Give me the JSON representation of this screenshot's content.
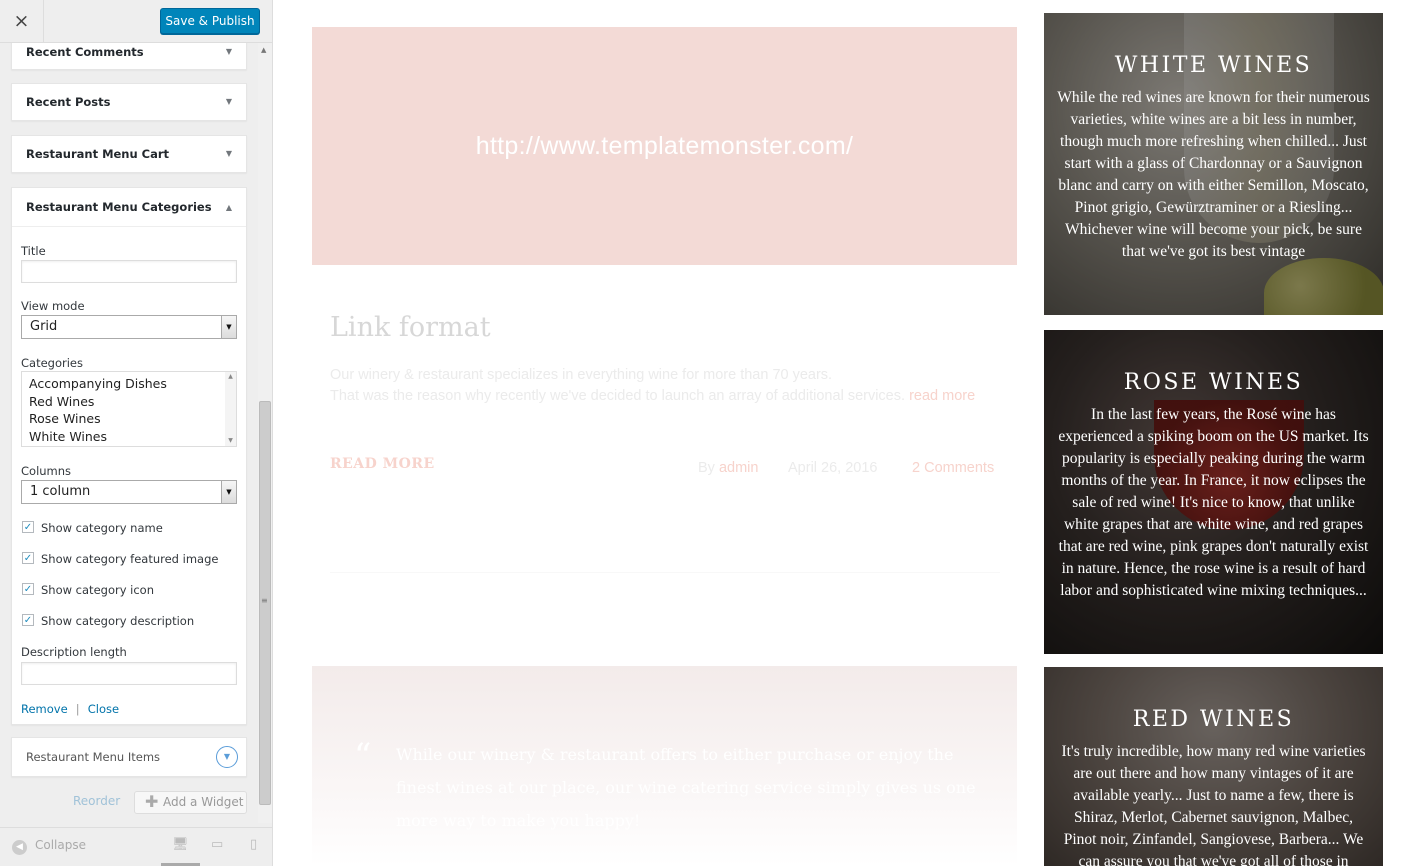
{
  "header": {
    "close_icon": "×",
    "publish_label": "Save & Publish"
  },
  "widgets": {
    "recent_comments": "Recent Comments",
    "recent_posts": "Recent Posts",
    "menu_cart": "Restaurant Menu Cart",
    "menu_categories": "Restaurant Menu Categories",
    "menu_items": "Restaurant Menu Items"
  },
  "form": {
    "title_label": "Title",
    "title_value": "",
    "view_mode_label": "View mode",
    "view_mode_value": "Grid",
    "categories_label": "Categories",
    "categories": [
      "Accompanying Dishes",
      "Red Wines",
      "Rose Wines",
      "White Wines"
    ],
    "columns_label": "Columns",
    "columns_value": "1 column",
    "checks": {
      "show_name": "Show category name",
      "show_image": "Show category featured image",
      "show_icon": "Show category icon",
      "show_description": "Show category description"
    },
    "description_length_label": "Description length",
    "description_length_value": "",
    "remove": "Remove",
    "separator": "|",
    "close": "Close"
  },
  "footer": {
    "reorder": "Reorder",
    "add_widget": "Add a Widget",
    "collapse": "Collapse"
  },
  "preview": {
    "link_url": "http://www.templatemonster.com/",
    "post_title": "Link format",
    "excerpt_line1": "Our winery & restaurant specializes in everything wine for more than 70 years.",
    "excerpt_line2": "That was the reason why recently we've decided to launch an array of additional services.",
    "excerpt_more": "read more",
    "read_more": "READ MORE",
    "by": "By",
    "author": "admin",
    "date": "April 26, 2016",
    "comments": "2 Comments",
    "quote_mark": "“",
    "quote": "While our winery & restaurant offers to either purchase or enjoy the finest wines at our place, our wine catering service simply gives us one more way to make you happy!"
  },
  "cards": {
    "white": {
      "title": "WHITE WINES",
      "text": "While the red wines are known for their numerous varieties, white wines are a bit less in number, though much more refreshing when chilled... Just start with a glass of Chardonnay or a Sauvignon blanc and carry on with either Semillon, Moscato, Pinot grigio, Gewürztraminer or a Riesling... Whichever wine will become your pick, be sure that we've got its best vintage"
    },
    "rose": {
      "title": "ROSE WINES",
      "text": "In the last few years, the Rosé wine has experienced a spiking boom on the US market. Its popularity is especially peaking during the warm months of the year. In France, it now eclipses the sale of red wine! It's nice to know, that unlike white grapes that are white wine, and red grapes that are red wine, pink grapes don't naturally exist in nature. Hence, the rose wine is a result of hard labor and sophisticated wine mixing techniques..."
    },
    "red": {
      "title": "RED WINES",
      "text": "It's truly incredible, how many red wine varieties are out there and how many vintages of it are available yearly... Just to name a few, there is Shiraz, Merlot, Cabernet sauvignon, Malbec, Pinot noir, Zinfandel, Sangiovese, Barbera... We can assure you that we've got all of those in"
    }
  },
  "colors": {
    "accent": "#0085ba",
    "banner": "#f3dad6",
    "pink_link": "#f7d3cc"
  }
}
